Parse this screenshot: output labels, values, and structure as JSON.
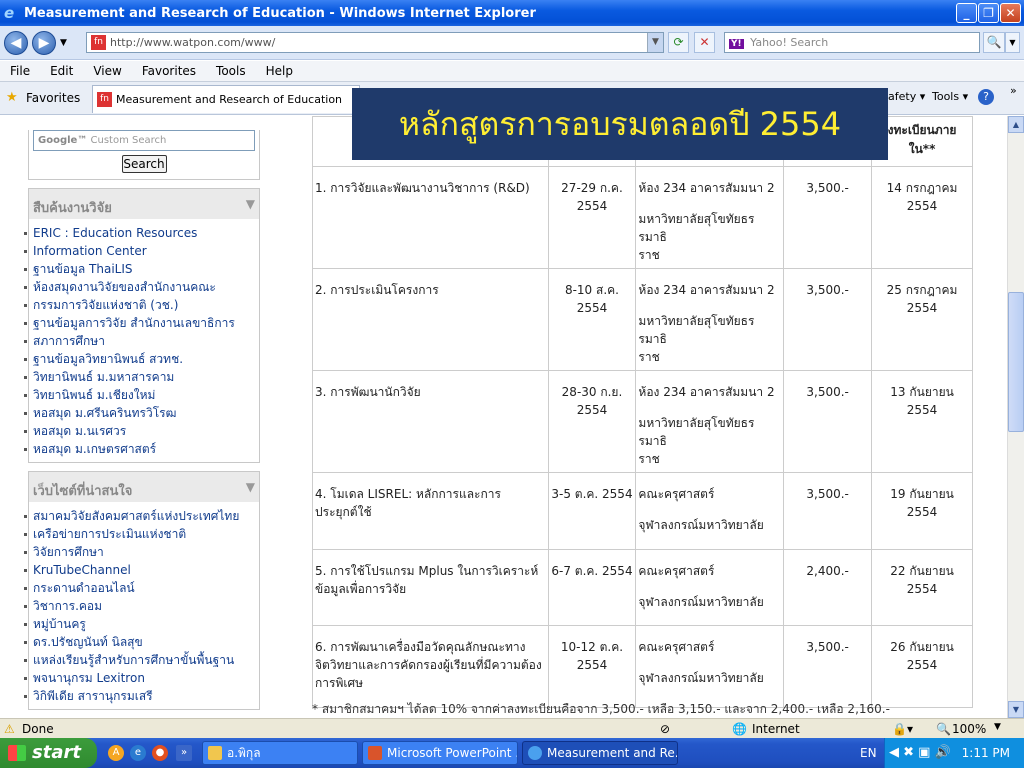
{
  "window": {
    "title": "Measurement and Research of Education - Windows Internet Explorer",
    "min": "_",
    "max": "❐",
    "close": "✕"
  },
  "nav": {
    "address": "http://www.watpon.com/www/",
    "favicon_text": "fn",
    "search_placeholder": "Yahoo! Search",
    "yahoo_mark": "Y!"
  },
  "menu": [
    "File",
    "Edit",
    "View",
    "Favorites",
    "Tools",
    "Help"
  ],
  "favorites_bar": {
    "label": "Favorites",
    "tab_title": "Measurement and Research of Education",
    "cmd_safety": "afety ▾",
    "cmd_tools": "Tools ▾",
    "cmd_help": "?",
    "chevron": "»"
  },
  "banner": "หลักสูตรการอบรมตลอดปี 2554",
  "sidebar": {
    "google_placeholder": "Custom Search",
    "google_logo": "Google™",
    "search_button": "Search",
    "research_heading": "สืบค้นงานวิจัย",
    "research_links": [
      "ERIC : Education Resources",
      "Information Center",
      "ฐานข้อมูล ThaiLIS",
      "ห้องสมุดงานวิจัยของสำนักงานคณะ",
      "กรรมการวิจัยแห่งชาติ (วช.)",
      "ฐานข้อมูลการวิจัย สำนักงานเลขาธิการ",
      "สภาการศึกษา",
      "ฐานข้อมูลวิทยานิพนธ์ สวทช.",
      "วิทยานิพนธ์ ม.มหาสารคาม",
      "วิทยานิพนธ์ ม.เชียงใหม่",
      "หอสมุด ม.ศรีนครินทรวิโรฒ",
      "หอสมุด ม.นเรศวร",
      "หอสมุด ม.เกษตรศาสตร์"
    ],
    "websites_heading": "เว็บไซต์ที่น่าสนใจ",
    "website_links": [
      "สมาคมวิจัยสังคมศาสตร์แห่งประเทศไทย",
      "เครือข่ายการประเมินแห่งชาติ",
      "วิจัยการศึกษา",
      "KruTubeChannel",
      "กระดานดำออนไลน์",
      "วิชาการ.คอม",
      "หมู่บ้านครู",
      "ดร.ปรัชญนันท์ นิลสุข",
      "แหล่งเรียนรู้สำหรับการศึกษาขั้นพื้นฐาน",
      "พจนานุกรม Lexitron",
      "วิกิพีเดีย สารานุกรมเสรี"
    ]
  },
  "table": {
    "header_partial": "งทะเบียนภาย\nใน**",
    "rows": [
      {
        "course": "1. การวิจัยและพัฒนางานวิชาการ (R&D)",
        "date": "27-29 ก.ค.\n2554",
        "place1": "ห้อง 234 อาคารสัมมนา 2",
        "place2": "มหาวิทยาลัยสุโขทัยธรรมาธิ\nราช",
        "fee": "3,500.-",
        "deadline": "14 กรกฎาคม\n2554"
      },
      {
        "course": "2. การประเมินโครงการ",
        "date": "8-10 ส.ค. 2554",
        "place1": "ห้อง 234 อาคารสัมมนา 2",
        "place2": "มหาวิทยาลัยสุโขทัยธรรมาธิ\nราช",
        "fee": "3,500.-",
        "deadline": "25 กรกฎาคม\n2554"
      },
      {
        "course": "3. การพัฒนานักวิจัย",
        "date": "28-30 ก.ย.\n2554",
        "place1": "ห้อง 234 อาคารสัมมนา 2",
        "place2": "มหาวิทยาลัยสุโขทัยธรรมาธิ\nราช",
        "fee": "3,500.-",
        "deadline": "13 กันยายน 2554"
      },
      {
        "course": "4. โมเดล LISREL: หลักการและการ\nประยุกต์ใช้",
        "date": "3-5 ต.ค. 2554",
        "place1": "คณะครุศาสตร์",
        "place2": "จุฬาลงกรณ์มหาวิทยาลัย",
        "fee": "3,500.-",
        "deadline": "19 กันยายน 2554"
      },
      {
        "course": "5. การใช้โปรแกรม Mplus ในการวิเคราะห์\nข้อมูลเพื่อการวิจัย",
        "date": "6-7 ต.ค. 2554",
        "place1": "คณะครุศาสตร์",
        "place2": "จุฬาลงกรณ์มหาวิทยาลัย",
        "fee": "2,400.-",
        "deadline": "22 กันยายน 2554"
      },
      {
        "course": "6. การพัฒนาเครื่องมือวัดคุณลักษณะทาง\nจิตวิทยาและการคัดกรองผู้เรียนที่มีความต้อง\nการพิเศษ",
        "date": "10-12 ต.ค.\n2554",
        "place1": "คณะครุศาสตร์",
        "place2": "จุฬาลงกรณ์มหาวิทยาลัย",
        "fee": "3,500.-",
        "deadline": "26 กันยายน 2554"
      }
    ],
    "note": "* สมาชิกสมาคมฯ ได้ลด 10% จากค่าลงทะเบียนคือจาก 3,500.- เหลือ 3,150.- และจาก 2,400.- เหลือ 2,160.-"
  },
  "status": {
    "text": "Done",
    "zone": "Internet",
    "zoom": "100%"
  },
  "taskbar": {
    "start": "start",
    "tasks": [
      "อ.พิกุล",
      "Microsoft PowerPoint ...",
      "Measurement and Re..."
    ],
    "lang": "EN",
    "time": "1:11 PM"
  }
}
